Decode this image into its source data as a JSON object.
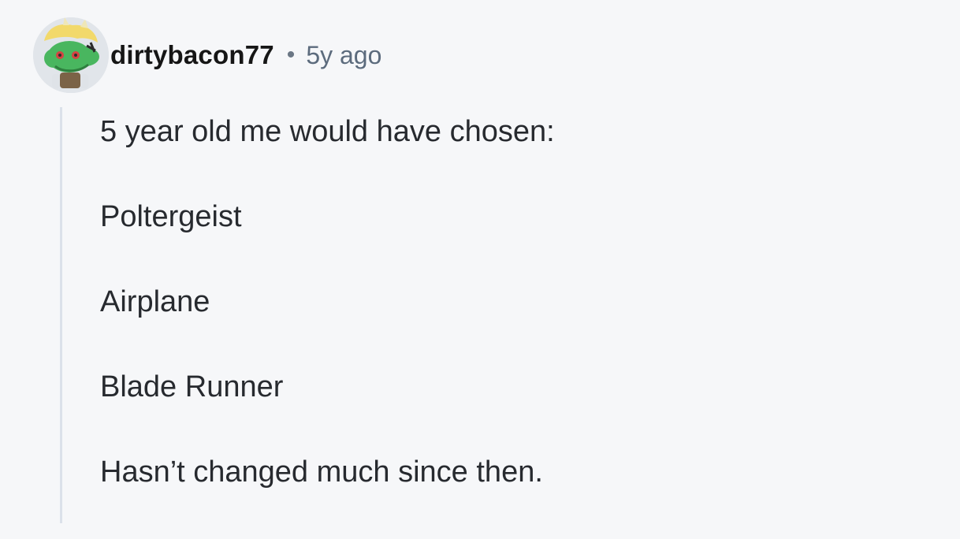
{
  "comment": {
    "username": "dirtybacon77",
    "separator": "•",
    "timestamp": "5y ago",
    "avatar_icon": "snoo-dragon-avatar-icon",
    "paragraphs": [
      "5 year old me would have chosen:",
      "Poltergeist",
      "Airplane",
      "Blade Runner",
      "Hasn’t changed much since then."
    ]
  },
  "colors": {
    "background": "#f6f7f9",
    "username": "#161616",
    "timestamp": "#5c6b7d",
    "body_text": "#272a2f",
    "thread_line": "#dbe1ea"
  }
}
